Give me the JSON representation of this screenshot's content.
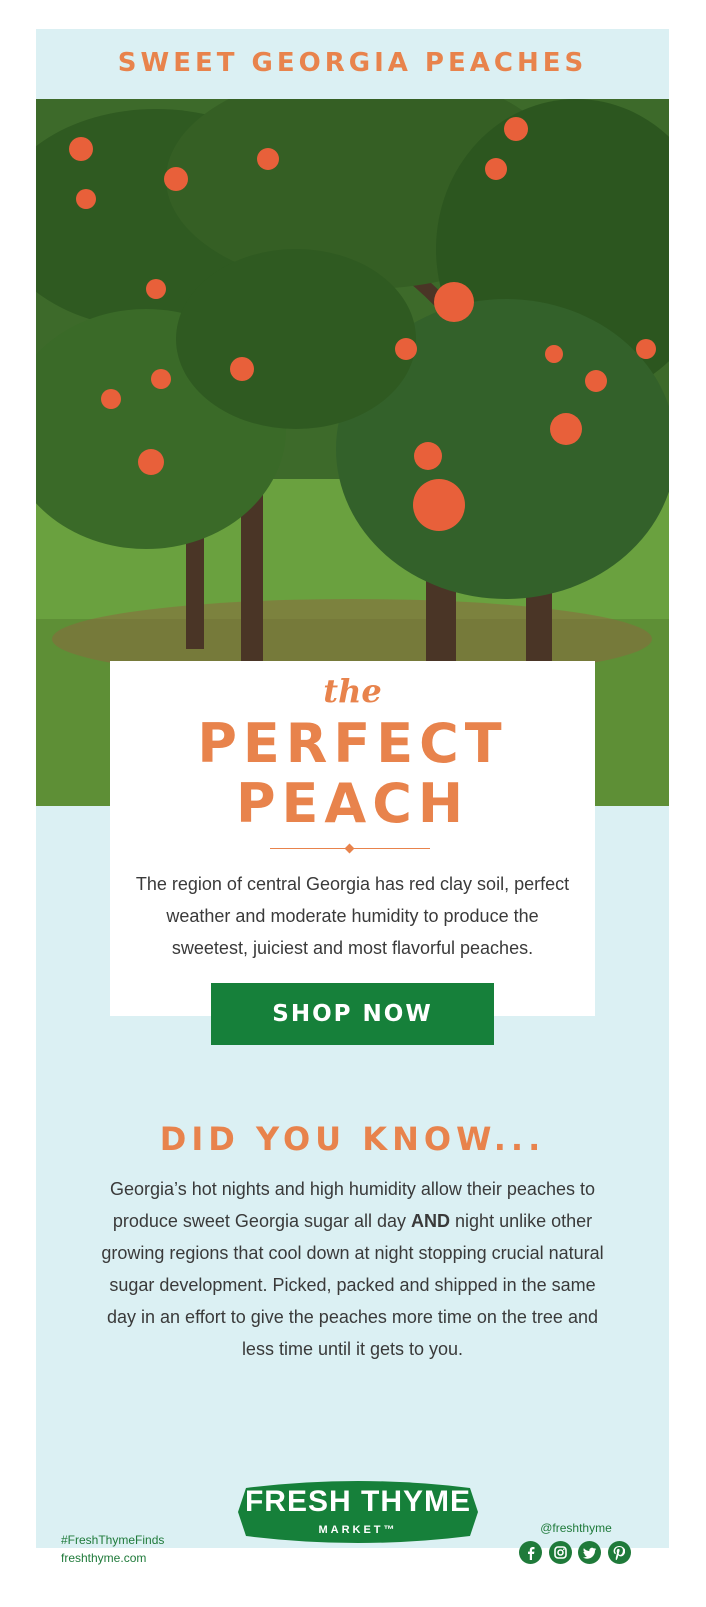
{
  "banner": {
    "title": "SWEET GEORGIA PEACHES"
  },
  "hero": {
    "image_alt": ""
  },
  "card": {
    "script": "the",
    "headline_line1": "PERFECT",
    "headline_line2": "PEACH",
    "body": "The region of central Georgia has red clay soil, perfect weather and moderate humidity to produce the sweetest, juiciest and most flavorful peaches."
  },
  "cta": {
    "label": "SHOP NOW"
  },
  "did_you_know": {
    "title": "DID YOU KNOW...",
    "body_part1": "Georgia’s hot nights and high humidity allow their peaches to produce sweet Georgia sugar all day ",
    "body_bold": "AND",
    "body_part2": " night unlike other growing regions that cool down at night stopping crucial natural sugar development. Picked, packed and shipped in the same day in an effort to give the peaches more time on the tree and less time until it gets to you."
  },
  "footer": {
    "hashtag": "#FreshThymeFinds",
    "website": "freshthyme.com",
    "handle": "@freshthyme",
    "logo_main": "FRESH THYME",
    "logo_sub": "MARKET™",
    "social_icons": [
      "facebook-icon",
      "instagram-icon",
      "twitter-icon",
      "pinterest-icon"
    ]
  },
  "colors": {
    "accent": "#e8834c",
    "panel": "#dbf0f3",
    "cta": "#16803a",
    "brand_green": "#1f7a3a"
  }
}
